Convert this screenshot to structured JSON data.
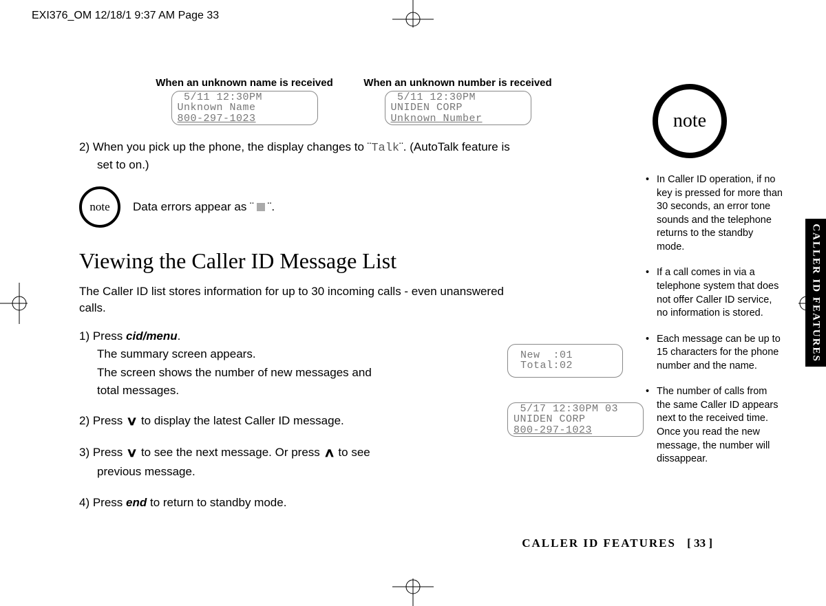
{
  "slug": "EXI376_OM  12/18/1 9:37 AM  Page 33",
  "side_tab": "CALLER ID FEATURES",
  "lcd_row": {
    "left": {
      "label": "When an unknown name is received",
      "line1": " 5/11 12:30PM",
      "line2": "Unknown Name",
      "line3": "800-297-1023"
    },
    "right": {
      "label": "When an unknown number is received",
      "line1": " 5/11 12:30PM",
      "line2": "UNIDEN CORP",
      "line3": "Unknown Number"
    }
  },
  "para2_pre": "2) When you pick up the phone, the display changes to ¨",
  "para2_mono": "Talk",
  "para2_post": "¨. (AutoTalk feature is",
  "para2_line2": "set to on.)",
  "note_small_label": "note",
  "note_small_text_pre": "Data errors appear as ¨",
  "note_small_text_post": "¨.",
  "section_title": "Viewing the Caller ID Message List",
  "section_intro": "The Caller ID list stores information for up to 30 incoming calls - even unanswered calls.",
  "steps": {
    "s1a": "1) Press ",
    "s1_cmd": "cid/menu",
    "s1b": ".",
    "s1_l2": "The summary screen appears.",
    "s1_l3": "The screen shows the number of new messages and total messages.",
    "s2a": "2) Press ",
    "s2b": " to display the latest Caller ID message.",
    "s3a": "3) Press ",
    "s3b": " to see the next message. Or press ",
    "s3c": " to see",
    "s3_l2": "previous message.",
    "s4a": "4) Press ",
    "s4_cmd": "end",
    "s4b": " to return to standby mode."
  },
  "lcd_float1": {
    "line1": "New  :01",
    "line2": "Total:02"
  },
  "lcd_float2": {
    "line1": " 5/17 12:30PM 03",
    "line2": "UNIDEN CORP",
    "line3": "800-297-1023"
  },
  "right": {
    "note_label": "note",
    "n1": "In Caller ID operation, if no key is pressed for more than 30 seconds, an error tone sounds and the telephone returns to the standby mode.",
    "n2": "If a call comes in via a telephone system that does not offer Caller ID service, no information is stored.",
    "n3": "Each message can be up to 15 characters for the phone number and the name.",
    "n4": "The number of calls from the same Caller ID appears next to the received time. Once you read the new message, the number will dissappear."
  },
  "footer_label": "CALLER ID FEATURES",
  "footer_page": "[ 33 ]"
}
